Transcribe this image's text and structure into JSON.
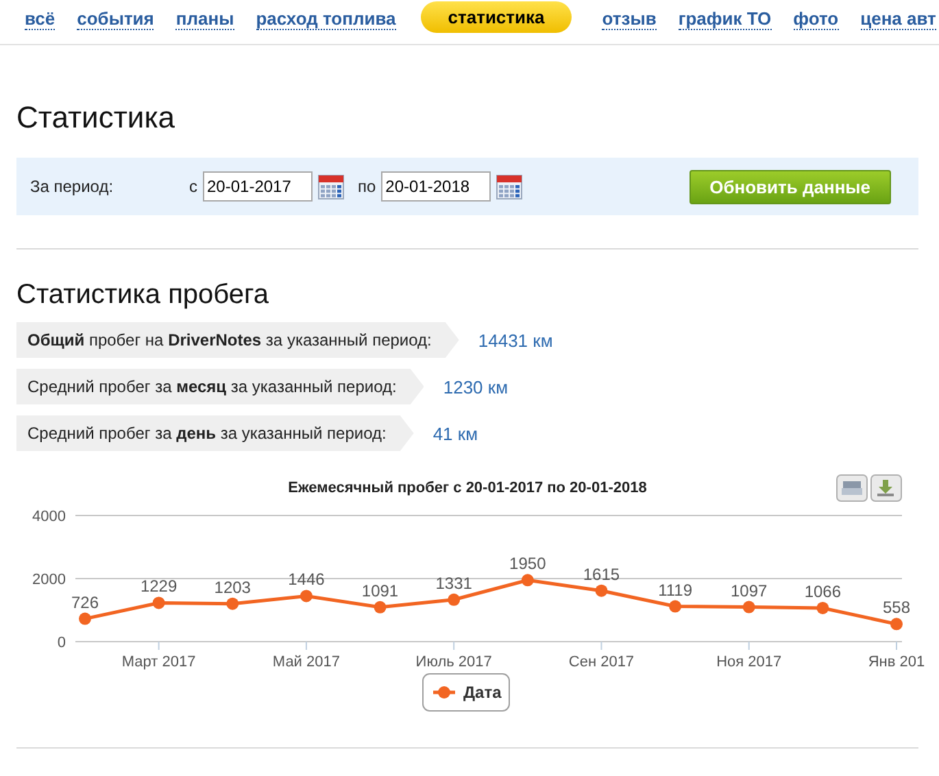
{
  "nav": [
    {
      "label": "всё",
      "selected": false
    },
    {
      "label": "события",
      "selected": false
    },
    {
      "label": "планы",
      "selected": false
    },
    {
      "label": "расход топлива",
      "selected": false
    },
    {
      "label": "статистика",
      "selected": true
    },
    {
      "label": "отзыв",
      "selected": false
    },
    {
      "label": "график ТО",
      "selected": false
    },
    {
      "label": "фото",
      "selected": false
    },
    {
      "label": "цена авт",
      "selected": false
    }
  ],
  "title": "Статистика",
  "period": {
    "label": "За период:",
    "from_label": "с",
    "from": "20-01-2017",
    "to_label": "по",
    "to": "20-01-2018",
    "button": "Обновить данные"
  },
  "mileage": {
    "title": "Статистика пробега",
    "rows": [
      {
        "text": "**Общий** пробег на **DriverNotes** за указанный период:",
        "value": "14431 км"
      },
      {
        "text": "Средний пробег за **месяц** за указанный период:",
        "value": "1230 км"
      },
      {
        "text": "Средний пробег за **день** за указанный период:",
        "value": "41 км"
      }
    ],
    "chart_data": {
      "type": "line",
      "title": "Ежемесячный пробег с 20-01-2017 по 20-01-2018",
      "categories": [
        null,
        "Март 2017",
        null,
        "Май 2017",
        null,
        "Июль 2017",
        null,
        "Сен 2017",
        null,
        "Ноя 2017",
        null,
        "Янв 201"
      ],
      "series": [
        {
          "name": "Дата",
          "color": "#f26522",
          "marker": "circle",
          "values": [
            726,
            1229,
            1203,
            1446,
            1091,
            1331,
            1950,
            1615,
            1119,
            1097,
            1066,
            558
          ]
        }
      ],
      "ylim": [
        0,
        4000
      ],
      "yticks": [
        0,
        2000,
        4000
      ],
      "data_labels": true
    }
  }
}
